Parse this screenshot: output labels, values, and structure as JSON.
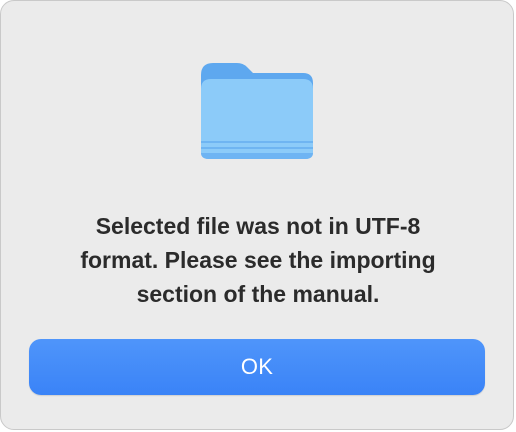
{
  "dialog": {
    "icon": "folder-icon",
    "message": "Selected file was not in UTF-8\nformat. Please see the importing\nsection of the manual.",
    "ok_label": "OK",
    "colors": {
      "background": "#ebebeb",
      "accent": "#3b85f7",
      "folder_light": "#8ccbf9",
      "folder_dark": "#5aa6ee"
    }
  }
}
